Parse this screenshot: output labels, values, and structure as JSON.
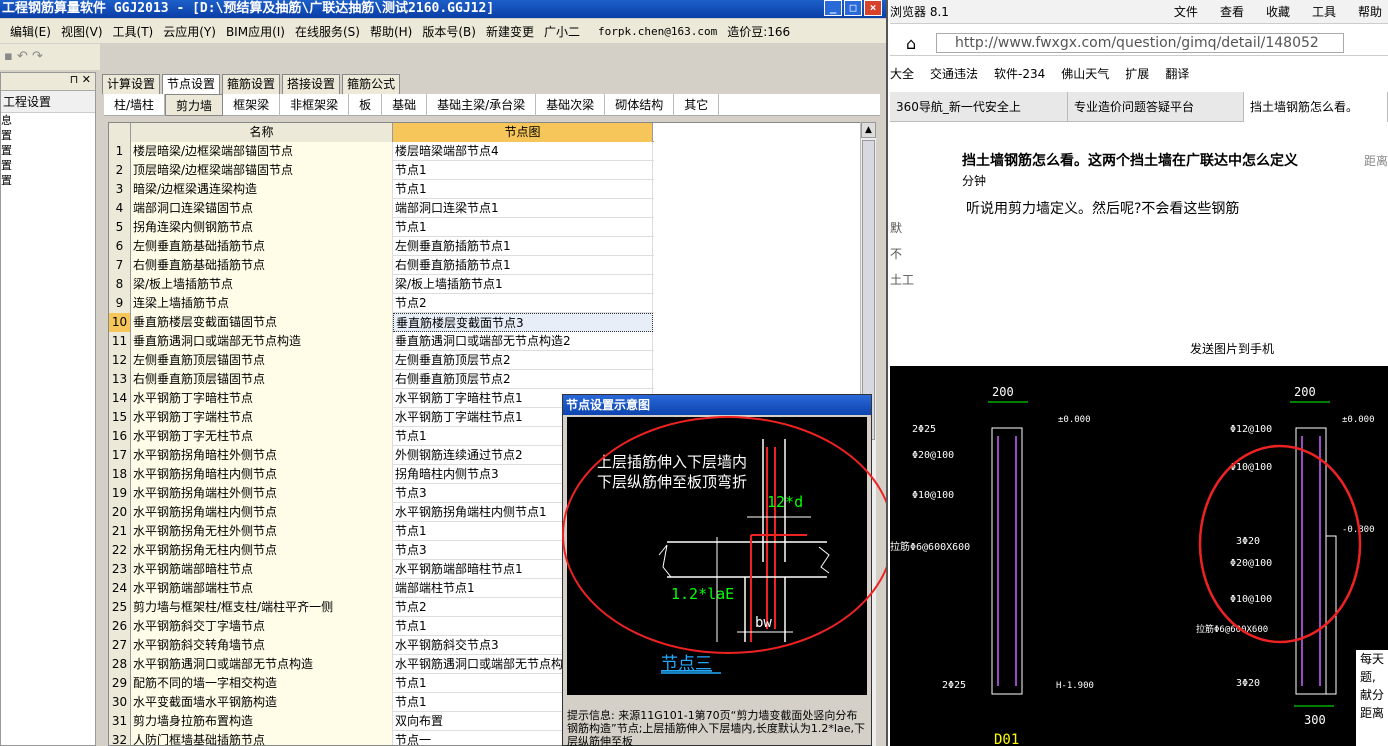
{
  "app": {
    "title": "工程钢筋算量软件 GGJ2013 - [D:\\预结算及抽筋\\广联达抽筋\\测试2160.GGJ12]",
    "menus": [
      "编辑(E)",
      "视图(V)",
      "工具(T)",
      "云应用(Y)",
      "BIM应用(I)",
      "在线服务(S)",
      "帮助(H)",
      "版本号(B)",
      "新建变更",
      "广小二"
    ],
    "user_email": "forpk.chen@163.com",
    "price_beans": "造价豆:166",
    "left_panel_title": "工程设置",
    "left_panel_items": [
      "息",
      "置",
      "置",
      "置",
      "置"
    ],
    "main_tabs": [
      "计算设置",
      "节点设置",
      "箍筋设置",
      "搭接设置",
      "箍筋公式"
    ],
    "sub_tabs": [
      "柱/墙柱",
      "剪力墙",
      "框架梁",
      "非框架梁",
      "板",
      "基础",
      "基础主梁/承台梁",
      "基础次梁",
      "砌体结构",
      "其它"
    ],
    "grid_headers": [
      "名称",
      "节点图"
    ],
    "rows": [
      {
        "num": "1",
        "name": "楼层暗梁/边框梁端部锚固节点",
        "node": "楼层暗梁端部节点4"
      },
      {
        "num": "2",
        "name": "顶层暗梁/边框梁端部锚固节点",
        "node": "节点1"
      },
      {
        "num": "3",
        "name": "暗梁/边框梁遇连梁构造",
        "node": "节点1"
      },
      {
        "num": "4",
        "name": "端部洞口连梁锚固节点",
        "node": "端部洞口连梁节点1"
      },
      {
        "num": "5",
        "name": "拐角连梁内侧钢筋节点",
        "node": "节点1"
      },
      {
        "num": "6",
        "name": "左侧垂直筋基础插筋节点",
        "node": "左侧垂直筋插筋节点1"
      },
      {
        "num": "7",
        "name": "右侧垂直筋基础插筋节点",
        "node": "右侧垂直筋插筋节点1"
      },
      {
        "num": "8",
        "name": "梁/板上墙插筋节点",
        "node": "梁/板上墙插筋节点1"
      },
      {
        "num": "9",
        "name": "连梁上墙插筋节点",
        "node": "节点2"
      },
      {
        "num": "10",
        "name": "垂直筋楼层变截面锚固节点",
        "node": "垂直筋楼层变截面节点3"
      },
      {
        "num": "11",
        "name": "垂直筋遇洞口或端部无节点构造",
        "node": "垂直筋遇洞口或端部无节点构造2"
      },
      {
        "num": "12",
        "name": "左侧垂直筋顶层锚固节点",
        "node": "左侧垂直筋顶层节点2"
      },
      {
        "num": "13",
        "name": "右侧垂直筋顶层锚固节点",
        "node": "右侧垂直筋顶层节点2"
      },
      {
        "num": "14",
        "name": "水平钢筋丁字暗柱节点",
        "node": "水平钢筋丁字暗柱节点1"
      },
      {
        "num": "15",
        "name": "水平钢筋丁字端柱节点",
        "node": "水平钢筋丁字端柱节点1"
      },
      {
        "num": "16",
        "name": "水平钢筋丁字无柱节点",
        "node": "节点1"
      },
      {
        "num": "17",
        "name": "水平钢筋拐角暗柱外侧节点",
        "node": "外侧钢筋连续通过节点2"
      },
      {
        "num": "18",
        "name": "水平钢筋拐角暗柱内侧节点",
        "node": "拐角暗柱内侧节点3"
      },
      {
        "num": "19",
        "name": "水平钢筋拐角端柱外侧节点",
        "node": "节点3"
      },
      {
        "num": "20",
        "name": "水平钢筋拐角端柱内侧节点",
        "node": "水平钢筋拐角端柱内侧节点1"
      },
      {
        "num": "21",
        "name": "水平钢筋拐角无柱外侧节点",
        "node": "节点1"
      },
      {
        "num": "22",
        "name": "水平钢筋拐角无柱内侧节点",
        "node": "节点3"
      },
      {
        "num": "23",
        "name": "水平钢筋端部暗柱节点",
        "node": "水平钢筋端部暗柱节点1"
      },
      {
        "num": "24",
        "name": "水平钢筋端部端柱节点",
        "node": "端部端柱节点1"
      },
      {
        "num": "25",
        "name": "剪力墙与框架柱/框支柱/端柱平齐一侧",
        "node": "节点2"
      },
      {
        "num": "26",
        "name": "水平钢筋斜交丁字墙节点",
        "node": "节点1"
      },
      {
        "num": "27",
        "name": "水平钢筋斜交转角墙节点",
        "node": "水平钢筋斜交节点3"
      },
      {
        "num": "28",
        "name": "水平钢筋遇洞口或端部无节点构造",
        "node": "水平钢筋遇洞口或端部无节点构"
      },
      {
        "num": "29",
        "name": "配筋不同的墙一字相交构造",
        "node": "节点1"
      },
      {
        "num": "30",
        "name": "水平变截面墙水平钢筋构造",
        "node": "节点1"
      },
      {
        "num": "31",
        "name": "剪力墙身拉筋布置构造",
        "node": "双向布置"
      },
      {
        "num": "32",
        "name": "人防门框墙基础插筋节点",
        "node": "节点一"
      }
    ],
    "popup": {
      "title": "节点设置示意图",
      "line1": "上层插筋伸入下层墙内",
      "line2": "下层纵筋伸至板顶弯折",
      "dim1": "12*d",
      "dim2": "1.2*laE",
      "dim3": "bw",
      "node_label": "节点三",
      "info": "提示信息: 来源11G101-1第70页“剪力墙变截面处竖向分布钢筋构造”节点;上层插筋伸入下层墙内,长度默认为1.2*lae,下层纵筋伸至板"
    }
  },
  "browser": {
    "title_partial": "浏览器 8.1",
    "menus": [
      "文件",
      "查看",
      "收藏",
      "工具",
      "帮助"
    ],
    "url": "http://www.fwxgx.com/question/gimq/detail/148052",
    "bookmarks": [
      "大全",
      "交通违法",
      "软件-234",
      "佛山天气",
      "扩展",
      "翻译"
    ],
    "tabs": [
      "360导航_新一代安全上",
      "专业造价问题答疑平台",
      "挡土墙钢筋怎么看。"
    ],
    "question": "挡土墙钢筋怎么看。这两个挡土墙在广联达中怎么定义",
    "question_time": "分钟",
    "far_label": "距离",
    "answer": "听说用剪力墙定义。然后呢?不会看这些钢筋",
    "side_text": [
      "默",
      "不",
      "土工"
    ],
    "send_to_phone": "发送图片到手机",
    "snippet": [
      "每天",
      "题,",
      "献分",
      "距离"
    ],
    "cad": {
      "dims_top": [
        "200",
        "200"
      ],
      "labels_left": [
        "2Φ25",
        "Φ20@100",
        "Φ10@100",
        "拉筋Φ6@600X600",
        "2Φ25"
      ],
      "labels_right": [
        "Φ12@100",
        "Φ10@100",
        "3Φ20",
        "Φ20@100",
        "Φ10@100",
        "拉筋Φ6@600X600",
        "3Φ20"
      ],
      "elev": [
        "±0.000",
        "±0.000",
        "-0.800",
        "H-1.900"
      ],
      "bottom_dim": "300",
      "section_label": "D01"
    }
  }
}
